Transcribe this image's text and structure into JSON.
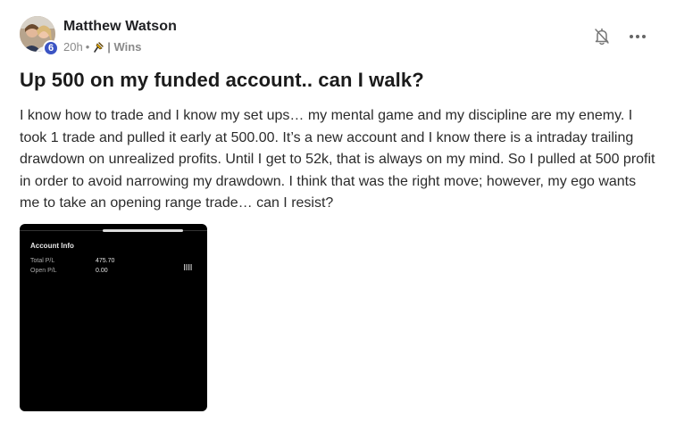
{
  "author": {
    "name": "Matthew Watson",
    "level": "6",
    "time": "20h",
    "separator": "•",
    "category": "| Wins"
  },
  "post": {
    "title": "Up 500 on my funded account.. can I walk?",
    "body": "I know how to trade and I know my set ups… my mental game and my discipline are my enemy. I took 1 trade and pulled it early at 500.00. It’s a new account and I know there is a intraday trailing drawdown on unrealized profits. Until I get to 52k, that is always on my mind. So I pulled at 500 profit in order to avoid narrowing my drawdown. I think that was the right move; however, my ego wants me to take an opening range trade… can I resist?"
  },
  "attachment": {
    "heading": "Account Info",
    "rows": [
      {
        "label": "Total P/L",
        "value": "475.70"
      },
      {
        "label": "Open P/L",
        "value": "0.00"
      }
    ]
  },
  "icons": {
    "bell": "bell-off-icon",
    "more": "more-dots-icon",
    "pin": "pin-icon"
  },
  "colors": {
    "level_badge": "#3b54c4",
    "title": "#1b1b1b",
    "meta": "#8a8a8a",
    "attachment_bg": "#000000"
  }
}
